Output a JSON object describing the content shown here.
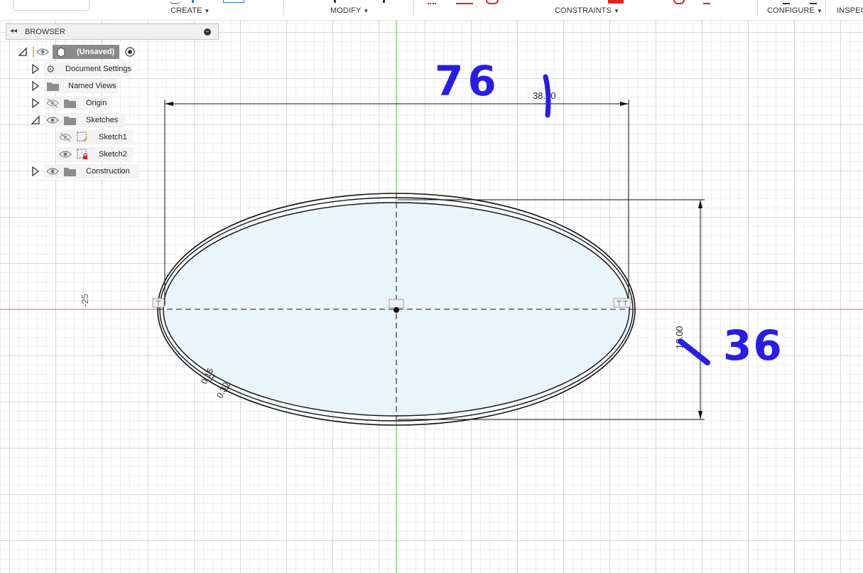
{
  "toolbar": {
    "groups": [
      "CREATE",
      "MODIFY",
      "CONSTRAINTS",
      "CONFIGURE",
      "INSPECT"
    ]
  },
  "browser": {
    "title": "BROWSER",
    "root": {
      "label": "(Unsaved)"
    },
    "items": [
      {
        "label": "Document Settings",
        "icon": "gear-icon"
      },
      {
        "label": "Named Views",
        "icon": "folder-icon"
      },
      {
        "label": "Origin",
        "icon": "folder-icon",
        "visible": false
      },
      {
        "label": "Sketches",
        "icon": "folder-icon",
        "visible": true
      },
      {
        "label": "Sketch1",
        "icon": "sketch-icon",
        "visible": false
      },
      {
        "label": "Sketch2",
        "icon": "sketch-locked-icon",
        "visible": true
      },
      {
        "label": "Construction",
        "icon": "folder-icon",
        "visible": true
      }
    ]
  },
  "sketch": {
    "dimensions": {
      "width": "38.00",
      "height": "18.00",
      "offset_a": "0.15",
      "offset_b": "0.30",
      "axis_label": "-25"
    },
    "annotations": {
      "width_note": "76",
      "height_note": "36"
    },
    "colors": {
      "x_axis": "#e8738a",
      "y_axis": "#4cc24c",
      "profile_fill": "#e9f4fb",
      "annotation_ink": "#2a1ce6"
    }
  }
}
